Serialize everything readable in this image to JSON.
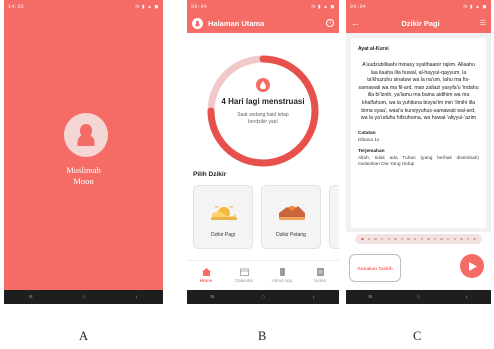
{
  "colors": {
    "brand": "#f56b66",
    "navbar": "#1e1e1e",
    "card": "#f4f4f4"
  },
  "phones": {
    "a": {
      "status_time": "14:05",
      "splash": {
        "title_line1": "Muslimah",
        "title_line2": "Moon",
        "icon": "woman-silhouette-icon"
      }
    },
    "b": {
      "status_time": "09:04",
      "appbar": {
        "title": "Halaman Utama",
        "info_icon": "info-icon"
      },
      "cycle": {
        "title": "4 Hari lagi menstruasi",
        "subtitle": "Saat sedang haid tetap berdzikir yaa!"
      },
      "section_title": "Pilih Dzikir",
      "cards": [
        {
          "label": "Dzikir Pagi",
          "icon": "sunrise-icon"
        },
        {
          "label": "Dzikir Petang",
          "icon": "sunset-icon"
        }
      ],
      "bottom_nav": [
        {
          "label": "Home",
          "icon": "home-icon",
          "active": true
        },
        {
          "label": "Calendar",
          "icon": "calendar-icon",
          "active": false
        },
        {
          "label": "About App",
          "icon": "phone-icon",
          "active": false
        },
        {
          "label": "Notes",
          "icon": "notes-icon",
          "active": false
        }
      ]
    },
    "c": {
      "status_time": "09:04",
      "appbar": {
        "title": "Dzikir Pagi"
      },
      "ayat_title": "Ayat al-Kursi",
      "arabic_text": "A'uudzubillaahi minasy syaithaanir rajiim. Allaahu laa ilaaha illa huwal, al-hayyul-qayyum, la ta'khuzuhu sinatuw wa la na'um, lahu ma fis-samawati wa ma fil-ard, man zallazi yasyfa'u 'indahu illa bi'iznih, ya'lamu ma baina aidihim wa ma khalfahum, wa la yuhituna bisyai'im min 'ilmihi illa bima syaa', wasi'a kursiyyuhus-samawati wal-ard, wa la ya'uduhu hifzuhuma, wa huwal-'aliyyul-'azim",
      "catatan_label": "Catatan",
      "catatan_value": "Dibaca 1x",
      "terjemahan_label": "Terjemahan",
      "terjemahan_value": "Allah, tidak ada Tuhan (yang berhak disembah) melainkan Dia Yang Hidup",
      "page_dots": {
        "count": 18,
        "active_index": 0
      },
      "tasbih_button": "Gunakan Tasbih",
      "play_icon": "play-icon"
    }
  },
  "captions": [
    "A",
    "B",
    "C"
  ]
}
